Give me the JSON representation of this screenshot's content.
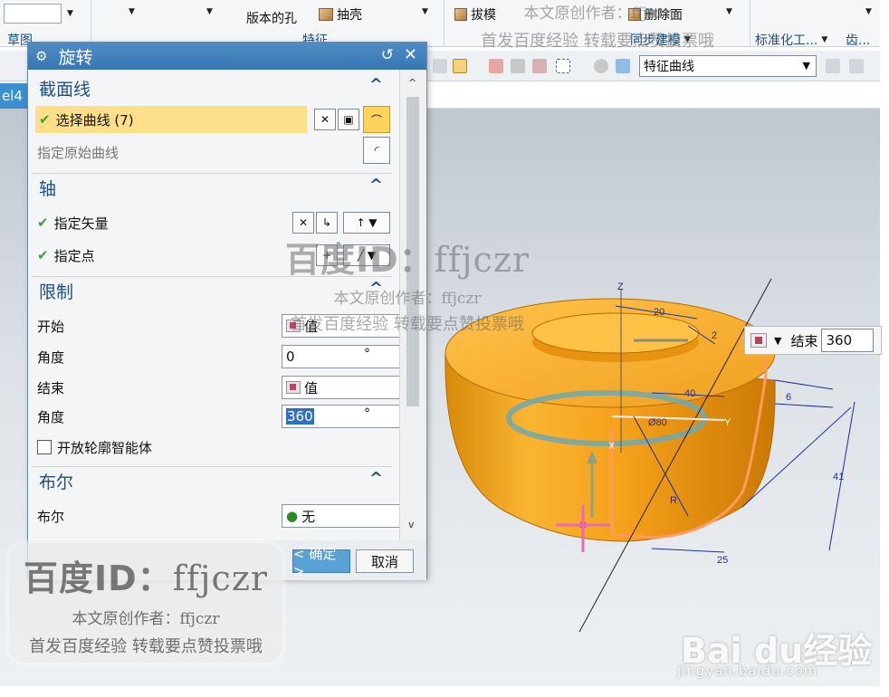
{
  "ribbon": {
    "col1_label": "草图",
    "hole_label": "版本的孔",
    "shell_label": "抽壳",
    "draft_label": "拔模",
    "delete_face_label": "删除面",
    "feature_group": "特征",
    "sync_label": "同步建模",
    "std_label": "标准化工...",
    "gear_label": "齿..."
  },
  "toolbar2": {
    "filter_value": "特征曲线"
  },
  "tabstrip": {
    "left_tab": "el4"
  },
  "dialog": {
    "title": "旋转",
    "sections": {
      "section_curve": "截面线",
      "axis": "轴",
      "limits": "限制",
      "boolean": "布尔"
    },
    "select_curve": "选择曲线 (7)",
    "specify_origin_curve": "指定原始曲线",
    "specify_vector": "指定矢量",
    "specify_point": "指定点",
    "start_label": "开始",
    "start_value": "值",
    "angle_label": "角度",
    "start_angle": "0",
    "end_label": "结束",
    "end_value": "值",
    "end_angle": "360",
    "degree_unit": "°",
    "open_profile": "开放轮廓智能体",
    "boolean_label": "布尔",
    "boolean_value": "无",
    "ok": "< 确定 >",
    "cancel": "取消"
  },
  "end_float": {
    "label": "结束",
    "value": "360"
  },
  "dims": {
    "d20": "20",
    "d2": "2",
    "d40": "40",
    "d80": "Ø80",
    "d6": "6",
    "d41": "41",
    "d25": "25",
    "dR": "R",
    "axis_z": "Z",
    "axis_y": "Y",
    "axis_x": "X"
  },
  "watermark": {
    "id_text": "百度ID：",
    "id_name": "ffjczr",
    "line1": "本文原创作者：ffjczr",
    "line2": "首发百度经验 转载要点赞投票哦",
    "top_line1": "本文原创作者：ffjczr",
    "top_line2": "首发百度经验 转载要点赞投票哦",
    "logo": "Bai du经验",
    "url": "jingyan.baidu.com"
  },
  "colors": {
    "accent": "#3776b2",
    "part": "#f5a623",
    "highlight": "#ffe08a"
  }
}
